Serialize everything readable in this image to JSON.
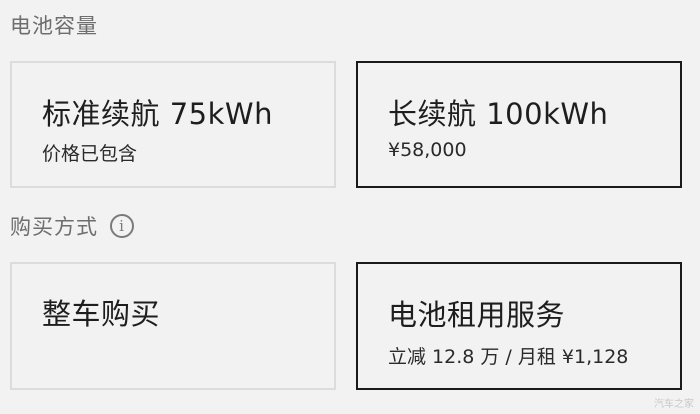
{
  "battery_section": {
    "label": "电池容量",
    "options": [
      {
        "title": "标准续航 75kWh",
        "subtitle": "价格已包含",
        "selected": false
      },
      {
        "title": "长续航 100kWh",
        "subtitle": "¥58,000",
        "selected": true
      }
    ]
  },
  "purchase_section": {
    "label": "购买方式",
    "info_icon": "info-circle-icon",
    "options": [
      {
        "title": "整车购买",
        "subtitle": "",
        "selected": false
      },
      {
        "title": "电池租用服务",
        "subtitle": "立减 12.8 万 / 月租 ¥1,128",
        "selected": true
      }
    ]
  },
  "watermark": "汽车之家"
}
